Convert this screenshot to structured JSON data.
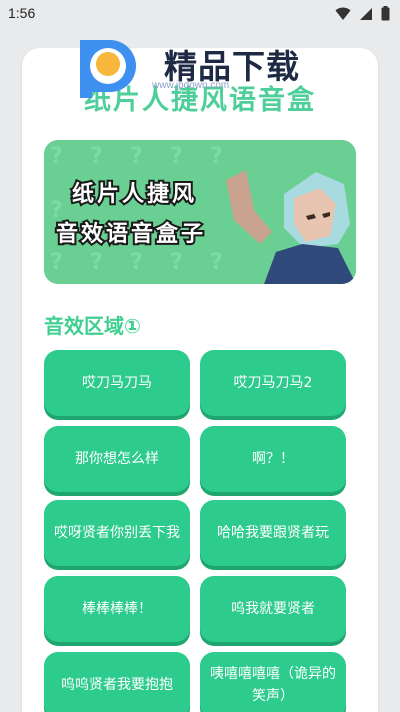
{
  "status_bar": {
    "time": "1:56"
  },
  "watermark": {
    "text": "精品下载",
    "url": "www.jpdown.com"
  },
  "app_title": "纸片人捷风语音盒",
  "banner": {
    "line1": "纸片人捷风",
    "line2": "音效语音盒子"
  },
  "section_title": "音效区域①",
  "buttons": [
    {
      "label": "哎刀马刀马"
    },
    {
      "label": "哎刀马刀马2"
    },
    {
      "label": "那你想怎么样"
    },
    {
      "label": "啊？！"
    },
    {
      "label": "哎呀贤者你别丢下我"
    },
    {
      "label": "哈哈我要跟贤者玩"
    },
    {
      "label": "棒棒棒棒！"
    },
    {
      "label": "呜我就要贤者"
    },
    {
      "label": "呜呜贤者我要抱抱"
    },
    {
      "label": "咦嘻嘻嘻嘻（诡异的笑声）"
    }
  ],
  "colors": {
    "accent": "#2dcb8c",
    "title": "#4ecf9a",
    "banner_bg": "#69cf93"
  }
}
